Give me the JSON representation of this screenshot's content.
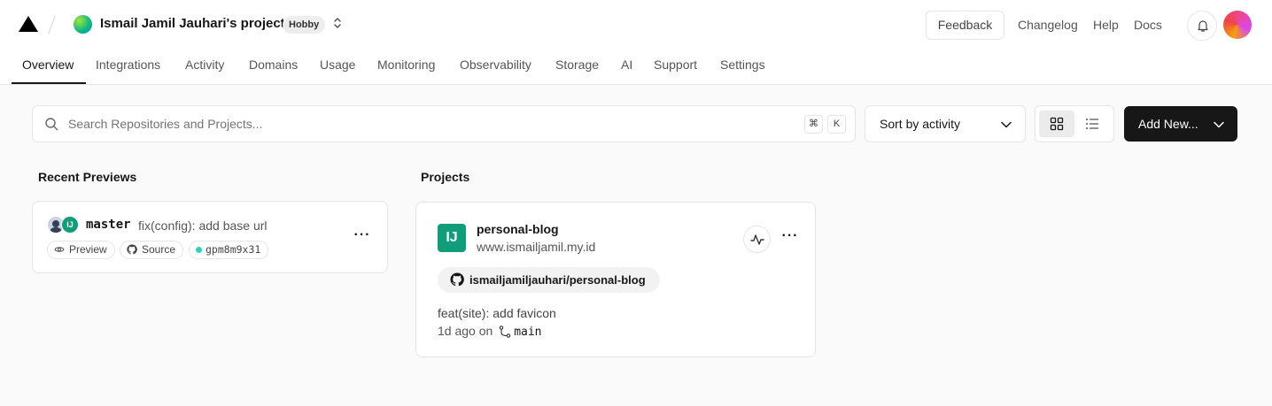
{
  "header": {
    "team_name": "Ismail Jamil Jauhari's projects",
    "plan_badge": "Hobby",
    "feedback_label": "Feedback",
    "links": [
      "Changelog",
      "Help",
      "Docs"
    ]
  },
  "tabs": [
    "Overview",
    "Integrations",
    "Activity",
    "Domains",
    "Usage",
    "Monitoring",
    "Observability",
    "Storage",
    "AI",
    "Support",
    "Settings"
  ],
  "active_tab": "Overview",
  "toolbar": {
    "search_placeholder": "Search Repositories and Projects...",
    "shortcut_keys": [
      "⌘",
      "K"
    ],
    "sort_label": "Sort by activity",
    "add_label": "Add New...",
    "view_mode": "grid"
  },
  "recent_previews": {
    "title": "Recent Previews",
    "items": [
      {
        "branch": "master",
        "message": "fix(config): add base url",
        "preview_label": "Preview",
        "source_label": "Source",
        "commit": "gpm8m9x31",
        "status_color": "#2dd4bf"
      }
    ]
  },
  "projects": {
    "title": "Projects",
    "items": [
      {
        "name": "personal-blog",
        "domain": "www.ismailjamil.my.id",
        "repo": "ismailjamiljauhari/personal-blog",
        "commit_message": "feat(site): add favicon",
        "time_ago": "1d ago on",
        "branch": "main",
        "icon_color": "#0f9d7a"
      }
    ]
  },
  "icons": {
    "logo": "vercel-triangle-icon",
    "bell": "bell-icon",
    "search": "search-icon",
    "grid": "grid-icon",
    "list": "list-icon",
    "github": "github-icon",
    "activity": "activity-pulse-icon"
  }
}
